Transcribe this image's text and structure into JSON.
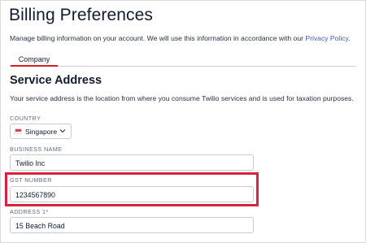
{
  "page": {
    "title": "Billing Preferences",
    "intro": "Manage billing information on your account. We will use this information in accordance with our ",
    "privacy_link": "Privacy Policy",
    "intro_end": "."
  },
  "tabs": [
    {
      "label": "Company",
      "active": true
    }
  ],
  "service_address": {
    "title": "Service Address",
    "description": "Your service address is the location from where you consume Twilio services and is used for taxation purposes."
  },
  "form": {
    "country": {
      "label": "COUNTRY",
      "value": "Singapore",
      "flag_icon": "singapore-flag-icon"
    },
    "business_name": {
      "label": "BUSINESS NAME",
      "value": "Twilio Inc"
    },
    "gst_number": {
      "label": "GST NUMBER",
      "value": "1234567890"
    },
    "address1": {
      "label": "ADDRESS 1*",
      "value": "15 Beach Road"
    }
  },
  "colors": {
    "accent_red": "#d9233d",
    "link_blue": "#3f5ac2",
    "border": "#c9ccd2"
  }
}
